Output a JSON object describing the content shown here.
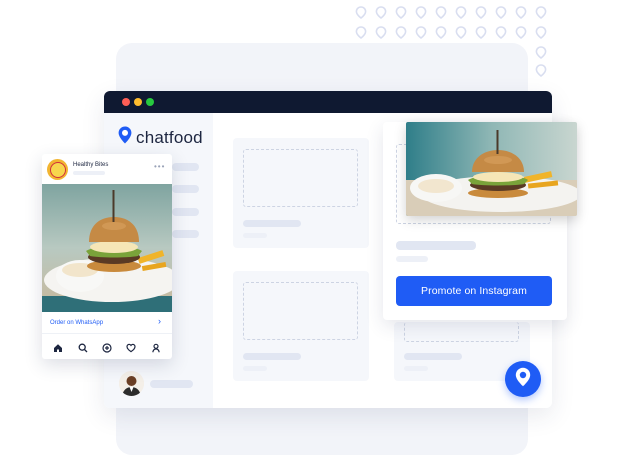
{
  "brand": {
    "name": "chatfood",
    "logo_icon": "chatfood-pin-logo-icon",
    "accent": "#1f5cf5"
  },
  "window": {
    "controls": [
      "close-dot-icon",
      "minimize-dot-icon",
      "maximize-dot-icon"
    ],
    "control_colors": [
      "#ff5f56",
      "#ffbd2e",
      "#27c93f"
    ],
    "titlebar_color": "#0f1931"
  },
  "promo": {
    "button_label": "Promote on Instagram",
    "image_icon": "burger-photo"
  },
  "phone_post": {
    "account_name": "Healthy Bites",
    "more_icon": "more-dots-icon",
    "cta_label": "Order on WhatsApp",
    "cta_icon": "chevron-right-icon",
    "nav_icons": [
      "home-icon",
      "search-icon",
      "add-icon",
      "heart-icon",
      "profile-icon"
    ]
  },
  "fab": {
    "icon": "chatfood-pin-icon"
  }
}
